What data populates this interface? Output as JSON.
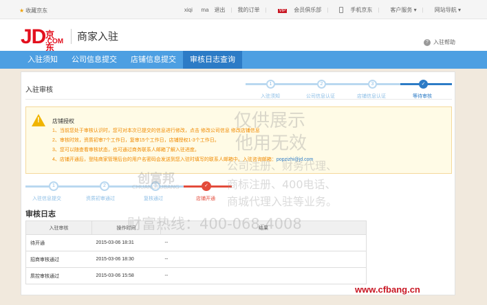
{
  "topbar": {
    "favorite": "收藏京东",
    "links": [
      "xiqi",
      "ma",
      "退出",
      "我的订单",
      "会员俱乐部",
      "手机京东",
      "客户服务",
      "网站导航"
    ],
    "vip_badge": "VIP"
  },
  "header": {
    "logo_jd": "JD",
    "logo_cn": "京东",
    "logo_com": ".COM",
    "title": "商家入驻",
    "help": "入驻帮助"
  },
  "nav": {
    "items": [
      "入驻须知",
      "公司信息提交",
      "店铺信息提交",
      "审核日志查询"
    ],
    "active_index": 3
  },
  "panel": {
    "title": "入驻审核",
    "steps": [
      {
        "num": "1",
        "label": "入驻须知"
      },
      {
        "num": "2",
        "label": "公司信息认证"
      },
      {
        "num": "3",
        "label": "店铺信息认证"
      },
      {
        "num": "✓",
        "label": "等待审核"
      }
    ]
  },
  "notice": {
    "icon": "warning-icon",
    "title": "店铺授权",
    "lines": [
      "1、当前您处于审核认识时，您可对本次已提交的信息进行修改，点击 修改公司信息 修改店铺信息",
      "2、审核时效，资质初审7个工作日，复审15个工作日，店铺授权1-3个工作日。",
      "3、您可以随查看审核状态，也可通过商务联系人邮箱了解入驻进度。",
      "4、店铺开通后，登陆商家管理后台的用户名密码会发送到您入驻时填写的联系人邮箱中。入驻咨询邮箱："
    ],
    "email": "popzizhi@jd.com"
  },
  "progress": {
    "steps": [
      {
        "num": "1",
        "label": "入驻信息提交"
      },
      {
        "num": "2",
        "label": "资质初审通过"
      },
      {
        "num": "3",
        "label": "复核通过"
      },
      {
        "num": "✓",
        "label": "店铺开通"
      }
    ]
  },
  "log": {
    "title": "审核日志",
    "headers": [
      "入驻审核",
      "操作时间",
      "结果"
    ],
    "rows": [
      {
        "status": "待开通",
        "time": "2015-03-06 18:31",
        "result": "--"
      },
      {
        "status": "招商审核通过",
        "time": "2015-03-06 18:30",
        "result": "--"
      },
      {
        "status": "质控审核通过",
        "time": "2015-03-06 15:58",
        "result": "--"
      }
    ]
  },
  "watermark": {
    "line1": "仅供展示",
    "line2": "他用无效",
    "line3": "公司注册、财务代理、",
    "line4": "商标注册、400电话、",
    "line5": "商城代理入驻等业务。",
    "brand": "创富邦",
    "brand_en": "CHUANGFUBANG",
    "hotline": "财富热线：400-068-4008",
    "url": "www.cfbang.cn"
  }
}
